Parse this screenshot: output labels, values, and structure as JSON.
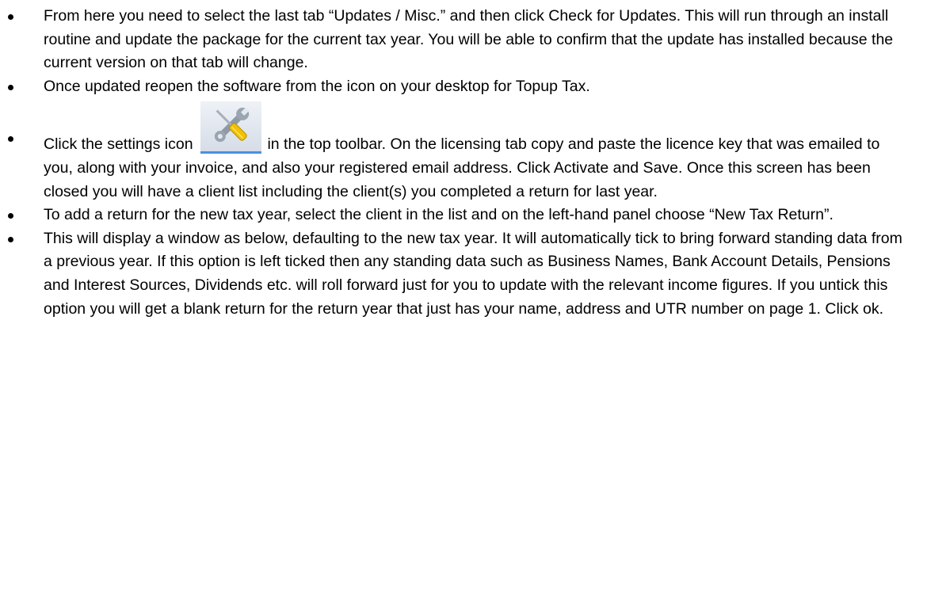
{
  "bullets": [
    {
      "text": "From here you need to select the last tab “Updates / Misc.” and then click Check for Updates. This will run through an install routine and update the package for the current tax year. You will be able to confirm that the update has installed because the current version on that tab will change."
    },
    {
      "text": "Once updated reopen the software from the icon on your desktop for Topup Tax."
    },
    {
      "text_before": "Click the settings icon",
      "icon": "settings-tools-icon",
      "text_after": "in the top toolbar. On the licensing tab copy and paste the licence key that was emailed to you, along with your invoice, and also your registered email address. Click Activate and Save. Once this screen has been closed you will have a client list including the client(s) you completed a return for last year."
    },
    {
      "text": "To add a return for the new tax year, select the client in the list and on the left-hand panel choose “New Tax Return”."
    },
    {
      "text": "This will display a window as below, defaulting to the new tax year. It will automatically tick to bring forward standing data from a previous year. If this option is left ticked then any standing data such as Business Names, Bank Account Details, Pensions and Interest Sources, Dividends etc. will roll forward just for you to update with the relevant income figures. If you untick this option you will get a blank return for the return year that just has your name, address and UTR number on page 1. Click ok."
    }
  ],
  "colors": {
    "text": "#000000",
    "icon_underline": "#4a90e2",
    "icon_bg": "#dde3eb"
  }
}
